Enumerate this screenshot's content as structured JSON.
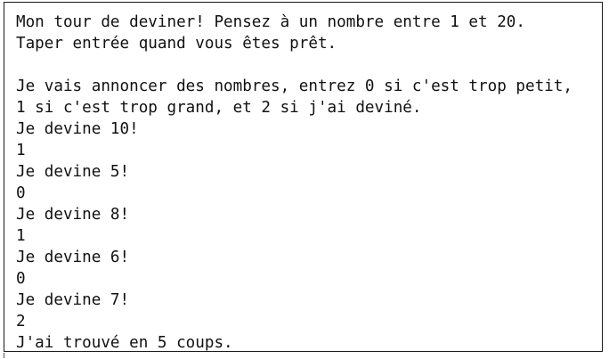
{
  "console": {
    "lines": [
      "Mon tour de deviner! Pensez à un nombre entre 1 et 20.",
      "Taper entrée quand vous êtes prêt.",
      "",
      "Je vais annoncer des nombres, entrez 0 si c'est trop petit,",
      "1 si c'est trop grand, et 2 si j'ai deviné.",
      "Je devine 10!",
      "1",
      "Je devine 5!",
      "0",
      "Je devine 8!",
      "1",
      "Je devine 6!",
      "0",
      "Je devine 7!",
      "2",
      "J'ai trouvé en 5 coups."
    ]
  }
}
